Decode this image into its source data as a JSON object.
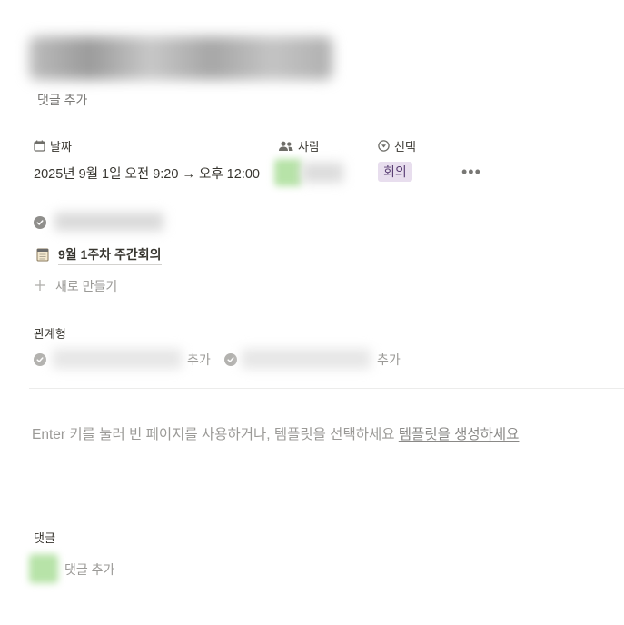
{
  "page": {
    "add_comment_top": "댓글 추가"
  },
  "properties": {
    "date": {
      "label": "날짜",
      "icon": "calendar-icon",
      "value": "2025년 9월 1일 오전 9:20 → 오후 12:00"
    },
    "person": {
      "label": "사람",
      "icon": "people-icon"
    },
    "select": {
      "label": "선택",
      "icon": "select-icon",
      "value": "회의",
      "tag_color": "#e8deee"
    },
    "more_label": "•••"
  },
  "linked_pages": {
    "items": [
      {
        "icon": "notepad-icon",
        "label": "9월 1주차 주간회의"
      }
    ],
    "new_label": "새로 만들기"
  },
  "relation": {
    "label": "관계형",
    "items": [
      {
        "add_label": "추가"
      },
      {
        "add_label": "추가"
      }
    ]
  },
  "body": {
    "empty_hint": "Enter 키를 눌러 빈 페이지를 사용하거나, 템플릿을 선택하세요",
    "template_link": "템플릿을 생성하세요"
  },
  "comments": {
    "label": "댓글",
    "add_label": "댓글 추가"
  }
}
